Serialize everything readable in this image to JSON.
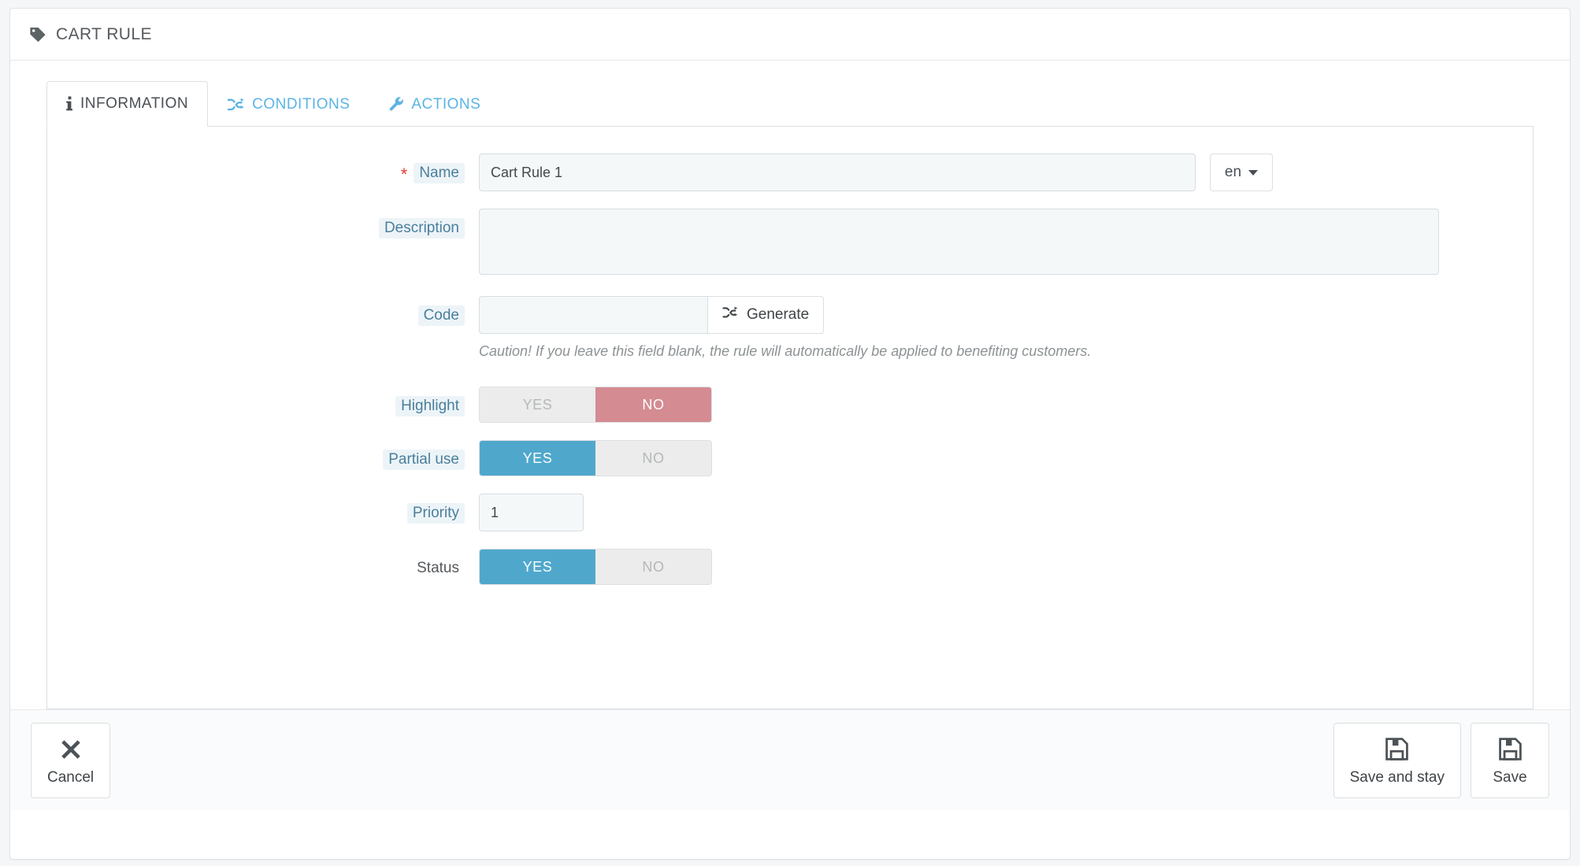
{
  "panel": {
    "title": "CART RULE",
    "icon": "tag-icon"
  },
  "tabs": [
    {
      "label": "INFORMATION",
      "icon": "info-icon",
      "active": true
    },
    {
      "label": "CONDITIONS",
      "icon": "shuffle-icon",
      "active": false
    },
    {
      "label": "ACTIONS",
      "icon": "wrench-icon",
      "active": false
    }
  ],
  "form": {
    "name": {
      "label": "Name",
      "required_marker": "*",
      "value": "Cart Rule 1",
      "placeholder": ""
    },
    "language": {
      "selected": "en",
      "icon": "chevron-down-icon"
    },
    "description": {
      "label": "Description",
      "value": "",
      "placeholder": ""
    },
    "code": {
      "label": "Code",
      "value": "",
      "placeholder": "",
      "generate_label": "Generate",
      "generate_icon": "shuffle-icon",
      "hint": "Caution! If you leave this field blank, the rule will automatically be applied to benefiting customers."
    },
    "highlight": {
      "label": "Highlight",
      "yes_label": "YES",
      "no_label": "NO",
      "value": "NO"
    },
    "partial_use": {
      "label": "Partial use",
      "yes_label": "YES",
      "no_label": "NO",
      "value": "YES"
    },
    "priority": {
      "label": "Priority",
      "value": "1"
    },
    "status": {
      "label": "Status",
      "yes_label": "YES",
      "no_label": "NO",
      "value": "YES"
    }
  },
  "footer": {
    "cancel": {
      "label": "Cancel",
      "icon": "close-x-icon"
    },
    "save_and_stay": {
      "label": "Save and stay",
      "icon": "floppy-save-icon"
    },
    "save": {
      "label": "Save",
      "icon": "floppy-save-icon"
    }
  },
  "colors": {
    "accent_blue": "#5bb4e5",
    "toggle_yes": "#4fa8cc",
    "toggle_no": "#d48b92",
    "label_text": "#4a7f9c",
    "label_bg": "#edf4f8",
    "required_red": "#e8392f"
  }
}
